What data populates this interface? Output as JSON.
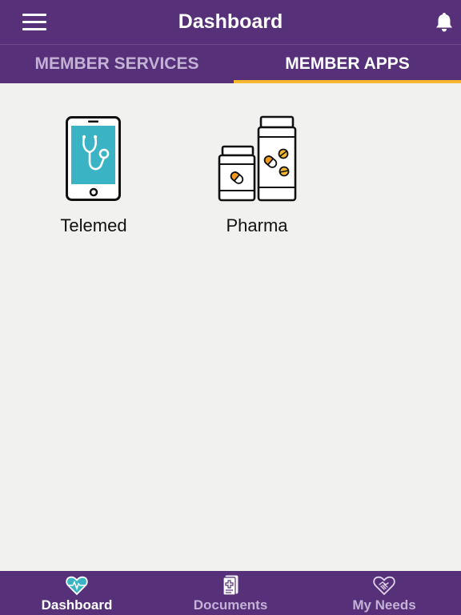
{
  "header": {
    "title": "Dashboard",
    "menu_icon": "hamburger-menu-icon",
    "notification_icon": "bell-icon"
  },
  "tabs": [
    {
      "label": "MEMBER SERVICES",
      "active": false
    },
    {
      "label": "MEMBER APPS",
      "active": true
    }
  ],
  "apps": [
    {
      "label": "Telemed",
      "icon": "phone-stethoscope-icon"
    },
    {
      "label": "Pharma",
      "icon": "pill-bottles-icon"
    }
  ],
  "bottom_nav": [
    {
      "label": "Dashboard",
      "icon": "heart-pulse-icon",
      "active": true
    },
    {
      "label": "Documents",
      "icon": "medical-document-icon",
      "active": false
    },
    {
      "label": "My Needs",
      "icon": "heart-handshake-icon",
      "active": false
    }
  ],
  "colors": {
    "primary": "#57307a",
    "accent": "#f5b82e",
    "background": "#f1f1f0",
    "telemed_screen": "#3ab3c4",
    "pill_orange": "#f29a1f"
  }
}
